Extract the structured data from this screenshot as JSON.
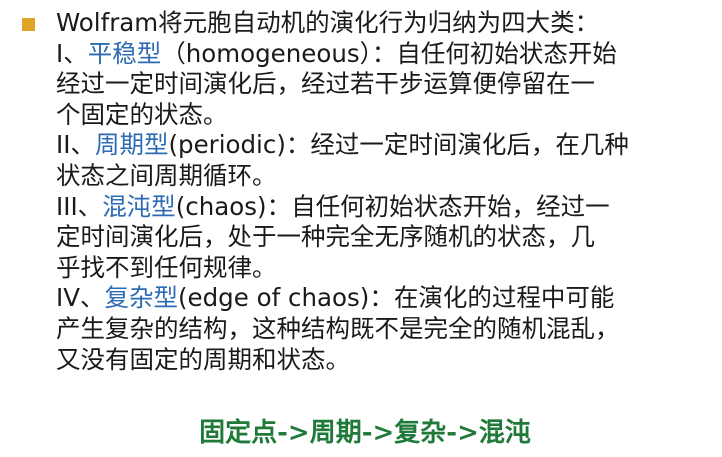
{
  "slide": {
    "intro": "Wolfram将元胞自动机的演化行为归纳为四大类：",
    "class1": {
      "numeral": "I、",
      "name": "平稳型",
      "line1_rest": "（homogeneous）：自任何初始状态开始",
      "line2": "经过一定时间演化后，经过若干步运算便停留在一",
      "line3": "个固定的状态。"
    },
    "class2": {
      "numeral": "II、",
      "name": "周期型",
      "line1_rest": "(periodic)：经过一定时间演化后，在几种",
      "line2": "状态之间周期循环。"
    },
    "class3": {
      "numeral": "III、",
      "name": "混沌型",
      "line1_rest": "(chaos)：自任何初始状态开始，经过一",
      "line2": "定时间演化后，处于一种完全无序随机的状态，几",
      "line3": "乎找不到任何规律。"
    },
    "class4": {
      "numeral": "IV、",
      "name": "复杂型",
      "line1_rest": "(edge of chaos)：在演化的过程中可能",
      "line2": "产生复杂的结构，这种结构既不是完全的随机混乱，",
      "line3": "又没有固定的周期和状态。"
    },
    "footer": "固定点->周期->复杂->混沌"
  },
  "colors": {
    "bullet": "#e0a526",
    "class_name": "#2d6bb3",
    "footer": "#1f7a3a"
  }
}
